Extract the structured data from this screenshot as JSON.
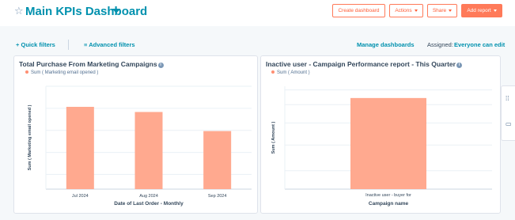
{
  "header": {
    "title": "Main KPIs Dashboard",
    "buttons": {
      "create": "Create dashboard",
      "actions": "Actions",
      "share": "Share",
      "add_report": "Add report"
    }
  },
  "filters": {
    "quick": "Quick filters",
    "advanced": "Advanced filters",
    "manage": "Manage dashboards",
    "assigned_label": "Assigned:",
    "assigned_value": "Everyone can edit"
  },
  "icons": {
    "star": "star-icon",
    "plus": "plus-icon",
    "filter": "filter-lines-icon",
    "info": "info-icon",
    "grid": "grid-dots-icon",
    "chat": "chat-icon"
  },
  "colors": {
    "brand": "#0091ae",
    "accent": "#ff7a59",
    "bar": "#ffa98f"
  },
  "chart_data": [
    {
      "type": "bar",
      "title": "Total Purchase From Marketing Campaigns",
      "legend": "Sum ( Marketing email opened )",
      "xlabel": "Date of Last Order - Monthly",
      "ylabel": "Sum ( Marketing email opened )",
      "categories": [
        "Jul 2024",
        "Aug 2024",
        "Sep 2024"
      ],
      "values": [
        112,
        105,
        79
      ],
      "ylim": [
        0,
        140
      ],
      "gridlines": [
        20,
        50,
        80,
        110,
        140
      ]
    },
    {
      "type": "bar",
      "title": "Inactive user - Campaign Performance report - This Quarter",
      "legend": "Sum ( Amount )",
      "xlabel": "Campaign name",
      "ylabel": "Sum ( Amount )",
      "categories": [
        "Inactive user - buyer for"
      ],
      "values": [
        124
      ],
      "ylim": [
        0,
        140
      ],
      "gridlines": [
        25,
        60,
        90,
        115,
        135
      ]
    }
  ]
}
